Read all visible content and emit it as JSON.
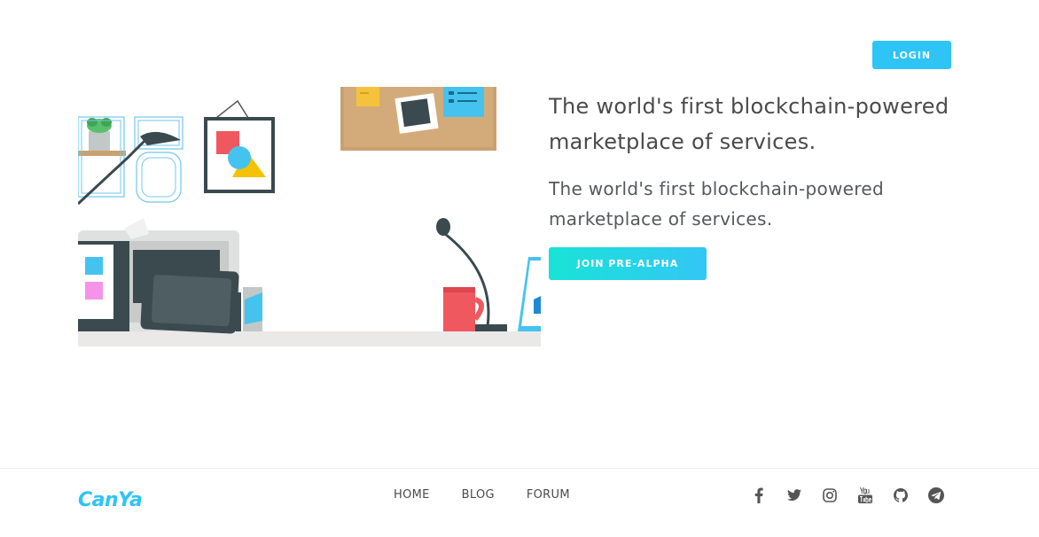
{
  "header": {
    "login_label": "LOGIN"
  },
  "hero": {
    "title": "The world's first blockchain-powered marketplace of services.",
    "subtitle": "The world's first blockchain-powered marketplace of services.",
    "cta_label": "JOIN PRE-ALPHA"
  },
  "footer": {
    "logo_text": "CanYa",
    "nav": [
      {
        "label": "HOME"
      },
      {
        "label": "BLOG"
      },
      {
        "label": "FORUM"
      }
    ],
    "social_icons": [
      "facebook-icon",
      "twitter-icon",
      "instagram-icon",
      "youtube-icon",
      "github-icon",
      "telegram-icon"
    ]
  },
  "colors": {
    "accent": "#2ec4f5",
    "gradient_start": "#19e3d6",
    "text": "#4a4a4a",
    "icon": "#555555"
  }
}
